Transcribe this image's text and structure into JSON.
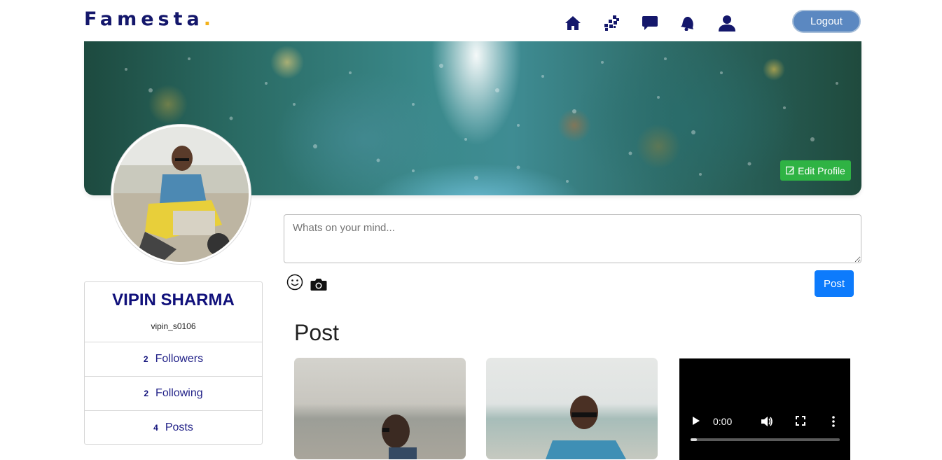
{
  "brand": {
    "name": "Famesta",
    "dot": ".",
    "accent": "#f3b21b",
    "color": "#14176b"
  },
  "nav": {
    "icons": [
      "home-icon",
      "apps-icon",
      "chat-icon",
      "notification-bell-icon",
      "profile-icon"
    ],
    "logout_label": "Logout"
  },
  "cover": {
    "edit_label": "Edit Profile"
  },
  "profile": {
    "name": "VIPIN SHARMA",
    "username": "vipin_s0106",
    "stats": [
      {
        "count": "2",
        "label": "Followers"
      },
      {
        "count": "2",
        "label": "Following"
      },
      {
        "count": "4",
        "label": "Posts"
      }
    ]
  },
  "composer": {
    "placeholder": "Whats on your mind...",
    "post_label": "Post"
  },
  "posts": {
    "title": "Post",
    "video": {
      "time": "0:00",
      "progress": 0.04
    }
  },
  "colors": {
    "primary": "#0d7bfc",
    "edit": "#2fb344",
    "logout": "#5b88c1",
    "navy": "#11117b"
  }
}
